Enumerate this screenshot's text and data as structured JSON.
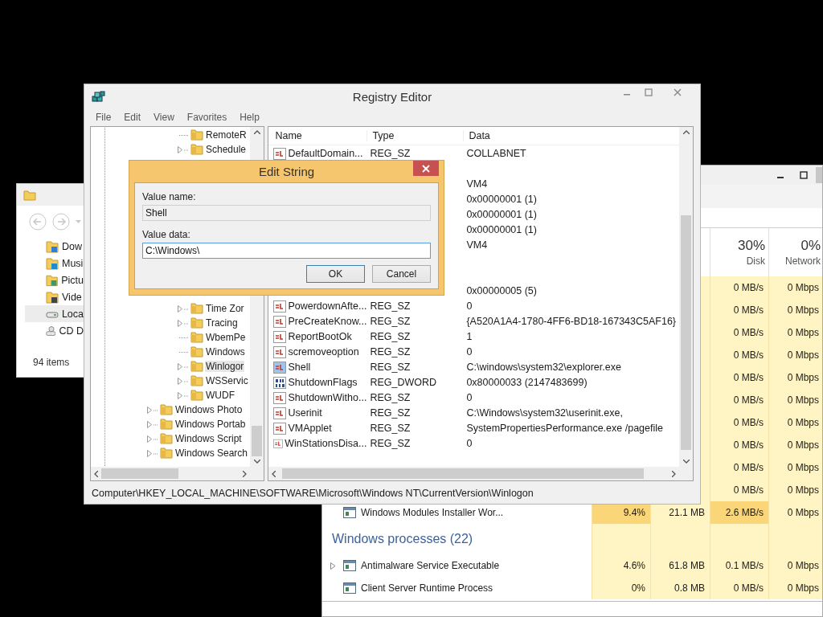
{
  "explorer": {
    "nav_items": [
      {
        "label": "Dow",
        "kind": "downloads",
        "selected": false
      },
      {
        "label": "Musi",
        "kind": "music",
        "selected": false
      },
      {
        "label": "Pictu",
        "kind": "pictures",
        "selected": false
      },
      {
        "label": "Vide",
        "kind": "videos",
        "selected": false
      },
      {
        "label": "Loca",
        "kind": "drive",
        "selected": true
      },
      {
        "label": "CD D",
        "kind": "cd",
        "selected": false
      }
    ],
    "status": "94 items"
  },
  "task_manager": {
    "columns": [
      {
        "percent": "30%",
        "label": "Disk"
      },
      {
        "percent": "0%",
        "label": "Network"
      }
    ],
    "rows": [
      {
        "kind": "process",
        "disk": {
          "text": "0 MB/s",
          "hot": false
        },
        "network": {
          "text": "0 Mbps",
          "hot": false
        }
      },
      {
        "kind": "process",
        "disk": {
          "text": "0 MB/s",
          "hot": false
        },
        "network": {
          "text": "0 Mbps",
          "hot": false
        }
      },
      {
        "kind": "process",
        "disk": {
          "text": "0 MB/s",
          "hot": false
        },
        "network": {
          "text": "0 Mbps",
          "hot": false
        }
      },
      {
        "kind": "process",
        "disk": {
          "text": "0 MB/s",
          "hot": false
        },
        "network": {
          "text": "0 Mbps",
          "hot": false
        }
      },
      {
        "kind": "process",
        "disk": {
          "text": "0 MB/s",
          "hot": false
        },
        "network": {
          "text": "0 Mbps",
          "hot": false
        }
      },
      {
        "kind": "process",
        "disk": {
          "text": "0 MB/s",
          "hot": false
        },
        "network": {
          "text": "0 Mbps",
          "hot": false
        }
      },
      {
        "kind": "process",
        "disk": {
          "text": "0 MB/s",
          "hot": false
        },
        "network": {
          "text": "0 Mbps",
          "hot": false
        }
      },
      {
        "kind": "process",
        "disk": {
          "text": "0 MB/s",
          "hot": false
        },
        "network": {
          "text": "0 Mbps",
          "hot": false
        }
      },
      {
        "kind": "process",
        "disk": {
          "text": "0 MB/s",
          "hot": false
        },
        "network": {
          "text": "0 Mbps",
          "hot": false
        }
      },
      {
        "kind": "process",
        "disk": {
          "text": "0 MB/s",
          "hot": false
        },
        "network": {
          "text": "0 Mbps",
          "hot": false
        }
      },
      {
        "kind": "process",
        "name": "Windows Modules Installer Wor...",
        "expandable": false,
        "cpu": {
          "text": "9.4%",
          "hot": true
        },
        "memory": {
          "text": "21.1 MB",
          "hot": false
        },
        "disk": {
          "text": "2.6 MB/s",
          "hot": true
        },
        "network": {
          "text": "0 Mbps",
          "hot": false
        }
      },
      {
        "kind": "group",
        "name": "Windows processes (22)"
      },
      {
        "kind": "process",
        "name": "Antimalware Service Executable",
        "expandable": true,
        "cpu": {
          "text": "4.6%",
          "hot": false
        },
        "memory": {
          "text": "61.8 MB",
          "hot": false
        },
        "disk": {
          "text": "0.1 MB/s",
          "hot": false
        },
        "network": {
          "text": "0 Mbps",
          "hot": false
        }
      },
      {
        "kind": "process",
        "name": "Client Server Runtime Process",
        "expandable": false,
        "cpu": {
          "text": "0%",
          "hot": false
        },
        "memory": {
          "text": "0.8 MB",
          "hot": false
        },
        "disk": {
          "text": "0 MB/s",
          "hot": false
        },
        "network": {
          "text": "0 Mbps",
          "hot": false
        }
      }
    ]
  },
  "registry_editor": {
    "title": "Registry Editor",
    "menu": [
      "File",
      "Edit",
      "View",
      "Favorites",
      "Help"
    ],
    "tree": [
      {
        "kind": "folder",
        "children": [
          {
            "kind": "folder",
            "label": "RemoteR",
            "expandable": false,
            "selected": false
          },
          {
            "kind": "folder",
            "label": "Schedule",
            "expandable": true,
            "selected": false
          },
          {
            "kind": "covered"
          },
          {
            "kind": "covered"
          },
          {
            "kind": "covered"
          },
          {
            "kind": "covered"
          },
          {
            "kind": "covered"
          },
          {
            "kind": "covered"
          },
          {
            "kind": "covered"
          },
          {
            "kind": "covered"
          },
          {
            "kind": "covered"
          },
          {
            "kind": "covered"
          },
          {
            "kind": "folder",
            "label": "Time Zor",
            "expandable": true,
            "selected": false
          },
          {
            "kind": "folder",
            "label": "Tracing",
            "expandable": true,
            "selected": false
          },
          {
            "kind": "folder",
            "label": "WbemPe",
            "expandable": false,
            "selected": false
          },
          {
            "kind": "folder",
            "label": "Windows",
            "expandable": false,
            "selected": false
          },
          {
            "kind": "folder",
            "label": "Winlogor",
            "expandable": true,
            "selected": true
          },
          {
            "kind": "folder",
            "label": "WSServic",
            "expandable": true,
            "selected": false
          },
          {
            "kind": "folder",
            "label": "WUDF",
            "expandable": true,
            "selected": false
          }
        ]
      },
      {
        "kind": "folder",
        "label": "Windows Photo",
        "expandable": true,
        "selected": false
      },
      {
        "kind": "folder",
        "label": "Windows Portab",
        "expandable": true,
        "selected": false
      },
      {
        "kind": "folder",
        "label": "Windows Script",
        "expandable": true,
        "selected": false
      },
      {
        "kind": "folder",
        "label": "Windows Search",
        "expandable": true,
        "selected": false
      }
    ],
    "columns": [
      "Name",
      "Type",
      "Data"
    ],
    "values": [
      {
        "kind": "string",
        "name": "DefaultDomain...",
        "type": "REG_SZ",
        "data": "COLLABNET",
        "selected": false
      },
      {
        "kind": "covered"
      },
      {
        "kind": "covered",
        "data": "VM4"
      },
      {
        "kind": "covered",
        "data": "0x00000001 (1)"
      },
      {
        "kind": "covered",
        "data": "0x00000001 (1)"
      },
      {
        "kind": "covered",
        "data": "0x00000001 (1)"
      },
      {
        "kind": "covered",
        "data": "VM4"
      },
      {
        "kind": "covered"
      },
      {
        "kind": "covered"
      },
      {
        "kind": "covered",
        "data": "0x00000005 (5)"
      },
      {
        "kind": "string",
        "name": "PowerdownAfte...",
        "type": "REG_SZ",
        "data": "0",
        "selected": false
      },
      {
        "kind": "string",
        "name": "PreCreateKnow...",
        "type": "REG_SZ",
        "data": "{A520A1A4-1780-4FF6-BD18-167343C5AF16}",
        "selected": false
      },
      {
        "kind": "string",
        "name": "ReportBootOk",
        "type": "REG_SZ",
        "data": "1",
        "selected": false
      },
      {
        "kind": "string",
        "name": "scremoveoption",
        "type": "REG_SZ",
        "data": "0",
        "selected": false
      },
      {
        "kind": "string",
        "name": "Shell",
        "type": "REG_SZ",
        "data": "C:\\windows\\system32\\explorer.exe",
        "selected": true
      },
      {
        "kind": "binary",
        "name": "ShutdownFlags",
        "type": "REG_DWORD",
        "data": "0x80000033 (2147483699)",
        "selected": false
      },
      {
        "kind": "string",
        "name": "ShutdownWitho...",
        "type": "REG_SZ",
        "data": "0",
        "selected": false
      },
      {
        "kind": "string",
        "name": "Userinit",
        "type": "REG_SZ",
        "data": "C:\\Windows\\system32\\userinit.exe,",
        "selected": false
      },
      {
        "kind": "string",
        "name": "VMApplet",
        "type": "REG_SZ",
        "data": "SystemPropertiesPerformance.exe /pagefile",
        "selected": false
      },
      {
        "kind": "string",
        "name": "WinStationsDisa...",
        "type": "REG_SZ",
        "data": "0",
        "selected": false
      }
    ],
    "status_bar": "Computer\\HKEY_LOCAL_MACHINE\\SOFTWARE\\Microsoft\\Windows NT\\CurrentVersion\\Winlogon"
  },
  "edit_string_dialog": {
    "title": "Edit String",
    "fields": [
      {
        "label": "Value name:",
        "value": "Shell",
        "read_only": true,
        "focused": false
      },
      {
        "label": "Value data:",
        "value": "C:\\Windows\\",
        "read_only": false,
        "focused": true
      }
    ],
    "buttons": [
      {
        "label": "OK",
        "default": true
      },
      {
        "label": "Cancel",
        "default": false
      }
    ]
  }
}
